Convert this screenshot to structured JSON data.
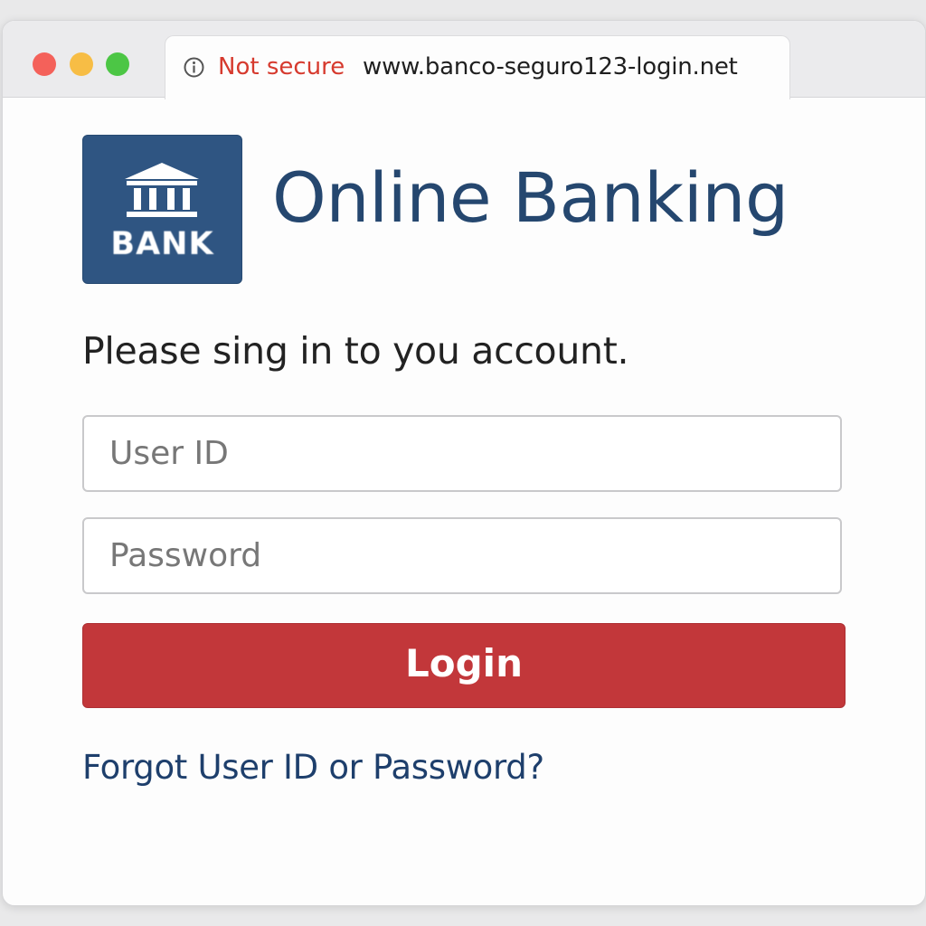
{
  "browser": {
    "security_label": "Not secure",
    "url": "www.banco-seguro123-login.net",
    "colors": {
      "close": "#f4615a",
      "minimize": "#f7bd45",
      "zoom": "#4cc645",
      "warning": "#d63a2e"
    },
    "icons": {
      "security": "info-circle-icon"
    }
  },
  "brand": {
    "logo_text": "BANK",
    "logo_icon": "bank-building-icon",
    "title": "Online Banking",
    "color": "#25476f"
  },
  "form": {
    "prompt": "Please sing in to you account.",
    "user_id": {
      "placeholder": "User ID",
      "value": ""
    },
    "password": {
      "placeholder": "Password",
      "value": ""
    },
    "login_label": "Login",
    "login_color": "#c2373a",
    "forgot_link": "Forgot User ID or Password?"
  }
}
